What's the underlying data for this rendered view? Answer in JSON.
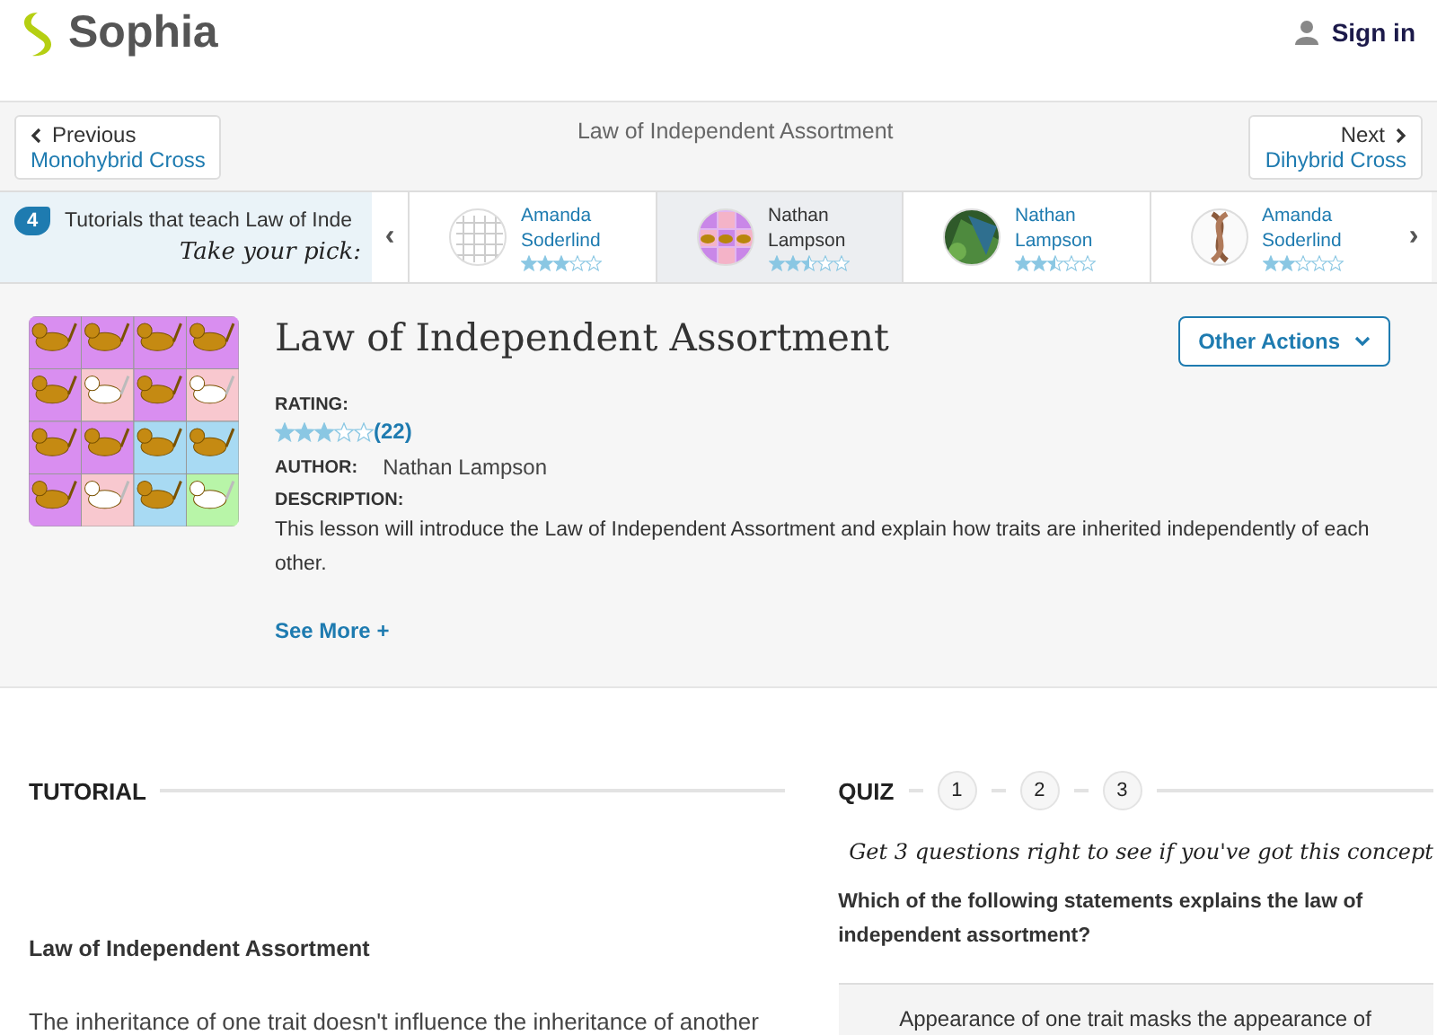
{
  "header": {
    "logo": "Sophia",
    "sign_in": "Sign in"
  },
  "nav": {
    "previous": {
      "label": "Previous",
      "title": "Monohybrid Cross"
    },
    "title": "Law of Independent Assortment",
    "next": {
      "label": "Next",
      "title": "Dihybrid Cross"
    }
  },
  "tutorials": {
    "count": "4",
    "text": "Tutorials that teach Law of Inde",
    "pick": "Take your pick:",
    "prev_arrow": "‹",
    "next_arrow": "›",
    "items": [
      {
        "first": "Amanda",
        "last": "Soderlind",
        "stars": 3,
        "selected": false,
        "kind": "grid"
      },
      {
        "first": "Nathan",
        "last": "Lampson",
        "stars": 2.5,
        "selected": true,
        "kind": "cats"
      },
      {
        "first": "Nathan",
        "last": "Lampson",
        "stars": 2.5,
        "selected": false,
        "kind": "leaf"
      },
      {
        "first": "Amanda",
        "last": "Soderlind",
        "stars": 2,
        "selected": false,
        "kind": "dna"
      }
    ]
  },
  "lesson": {
    "title": "Law of Independent Assortment",
    "actions": "Other Actions",
    "rating_label": "RATING:",
    "stars": 3,
    "rating_count": "(22)",
    "author_label": "AUTHOR:",
    "author": "Nathan Lampson",
    "description_label": "DESCRIPTION:",
    "description": "This lesson will introduce the Law of Independent Assortment and explain how traits are inherited independently of each other.",
    "see_more": "See More +"
  },
  "tutorial": {
    "heading": "TUTORIAL",
    "subtitle": "Law of Independent Assortment",
    "body": "The inheritance of one trait doesn't influence the inheritance of another"
  },
  "quiz": {
    "heading": "QUIZ",
    "steps": [
      {
        "label": "1",
        "selected": false
      },
      {
        "label": "2",
        "selected": false
      },
      {
        "label": "3",
        "selected": false
      }
    ],
    "prompt": "Get 3 questions right to see if you've got this concept",
    "question": "Which of the following statements explains the law of independent assortment?",
    "answer": "Appearance of one trait masks the appearance of"
  }
}
